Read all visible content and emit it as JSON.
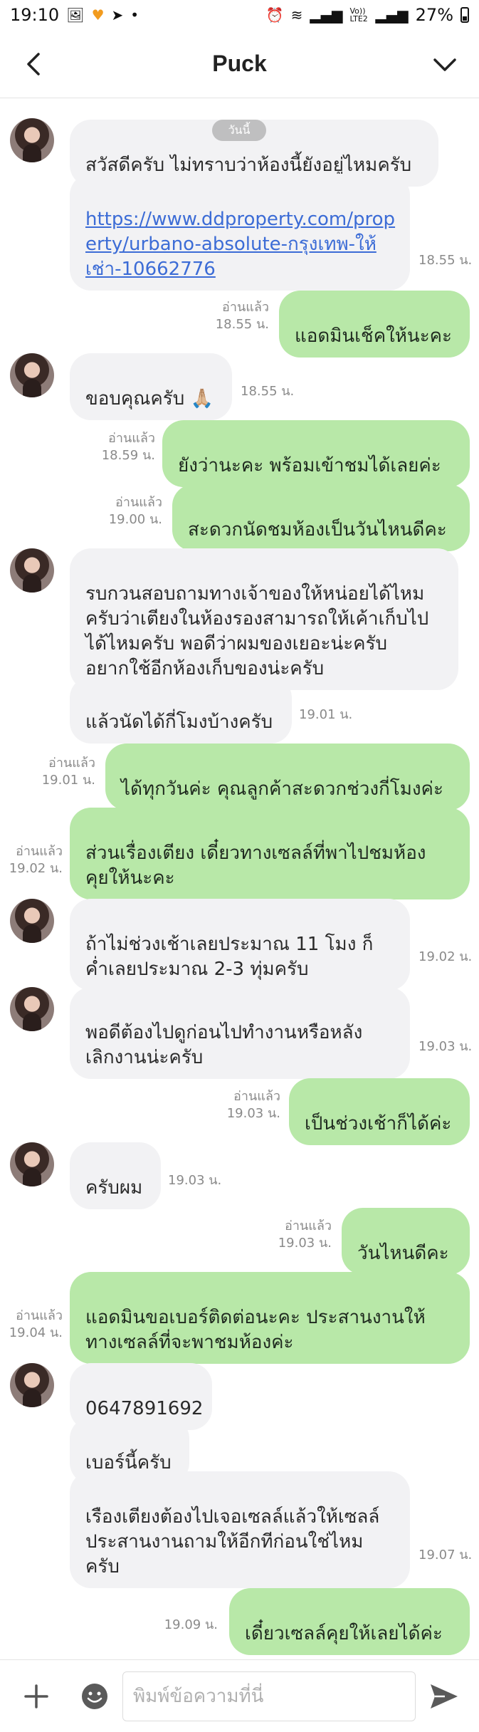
{
  "status_bar": {
    "time": "19:10",
    "battery": "27%",
    "net_label": "Vo)) LTE2"
  },
  "header": {
    "title": "Puck"
  },
  "chat": {
    "date_divider": "วันนี้",
    "messages": [
      {
        "dir": "in",
        "avatar": true,
        "text": "สวัสดีครับ ไม่ทราบว่าห้องนี้ยังอยู่ไหมครับ",
        "time": "",
        "read": ""
      },
      {
        "dir": "in",
        "avatar": false,
        "link": true,
        "text": "https://www.ddproperty.com/prop\nerty/urbano-absolute-กรุงเทพ-ให้\nเช่า-10662776",
        "time": "18.55 น.",
        "read": ""
      },
      {
        "dir": "out",
        "text": "แอดมินเช็คให้นะคะ",
        "time": "18.55 น.",
        "read": "อ่านแล้ว"
      },
      {
        "dir": "in",
        "avatar": true,
        "text": "ขอบคุณครับ 🙏🏼",
        "time": "18.55 น.",
        "read": ""
      },
      {
        "dir": "out",
        "text": "ยังว่านะคะ พร้อมเข้าชมได้เลยค่ะ",
        "time": "18.59 น.",
        "read": "อ่านแล้ว"
      },
      {
        "dir": "out",
        "text": "สะดวกนัดชมห้องเป็นวันไหนดีคะ",
        "time": "19.00 น.",
        "read": "อ่านแล้ว"
      },
      {
        "dir": "in",
        "avatar": true,
        "text": "รบกวนสอบถามทางเจ้าของให้หน่อยได้ไหม\nครับว่าเตียงในห้องรองสามารถให้เค้าเก็บไป\nได้ไหมครับ พอดีว่าผมของเยอะน่ะครับ\nอยากใช้อีกห้องเก็บของน่ะครับ",
        "time": "",
        "read": ""
      },
      {
        "dir": "in",
        "avatar": false,
        "text": "แล้วนัดได้กี่โมงบ้างครับ",
        "time": "19.01 น.",
        "read": ""
      },
      {
        "dir": "out",
        "text": "ได้ทุกวันค่ะ คุณลูกค้าสะดวกช่วงกี่โมงค่ะ",
        "time": "19.01 น.",
        "read": "อ่านแล้ว"
      },
      {
        "dir": "out",
        "text": "ส่วนเรื่องเตียง เดี๋ยวทางเซลล์ที่พาไปชมห้อง\nคุยให้นะคะ",
        "time": "19.02 น.",
        "read": "อ่านแล้ว"
      },
      {
        "dir": "in",
        "avatar": true,
        "text": "ถ้าไม่ช่วงเช้าเลยประมาณ 11 โมง ก็\nค่ำเลยประมาณ 2-3 ทุ่มครับ",
        "time": "19.02 น.",
        "read": ""
      },
      {
        "dir": "in",
        "avatar": true,
        "text": "พอดีต้องไปดูก่อนไปทำงานหรือหลัง\nเลิกงานน่ะครับ",
        "time": "19.03 น.",
        "read": ""
      },
      {
        "dir": "out",
        "text": "เป็นช่วงเช้าก็ได้ค่ะ",
        "time": "19.03 น.",
        "read": "อ่านแล้ว"
      },
      {
        "dir": "in",
        "avatar": true,
        "text": "ครับผม",
        "time": "19.03 น.",
        "read": ""
      },
      {
        "dir": "out",
        "text": "วันไหนดีคะ",
        "time": "19.03 น.",
        "read": "อ่านแล้ว"
      },
      {
        "dir": "out",
        "text": "แอดมินขอเบอร์ติดต่อนะคะ ประสานงานให้\nทางเซลล์ที่จะพาชมห้องค่ะ",
        "time": "19.04 น.",
        "read": "อ่านแล้ว"
      },
      {
        "dir": "in",
        "avatar": true,
        "text": "0647891692",
        "time": "",
        "read": ""
      },
      {
        "dir": "in",
        "avatar": false,
        "text": "เบอร์นี้ครับ",
        "time": "",
        "read": ""
      },
      {
        "dir": "in",
        "avatar": false,
        "text": "เรืองเตียงต้องไปเจอเซลล์แล้วให้เซลล์\nประสานงานถามให้อีกทีก่อนใช่ไหม\nครับ",
        "time": "19.07 น.",
        "read": ""
      },
      {
        "dir": "out",
        "text": "เดี๋ยวเซลล์คุยให้เลยได้ค่ะ",
        "time": "19.09 น.",
        "read": ""
      }
    ]
  },
  "input_bar": {
    "placeholder": "พิมพ์ข้อความที่นี่"
  },
  "colors": {
    "incoming_bubble": "#f2f2f4",
    "outgoing_bubble": "#b8e8a8",
    "link": "#3c6cd6",
    "meta_text": "#8a8a8a"
  }
}
